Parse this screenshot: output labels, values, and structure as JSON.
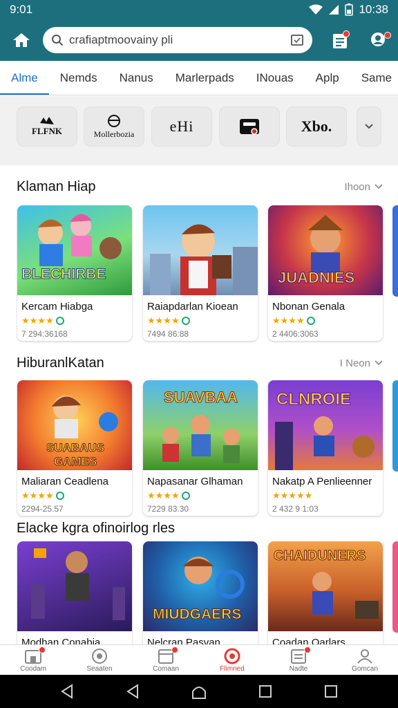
{
  "status": {
    "time": "9:01",
    "clock": "10:38"
  },
  "search": {
    "value": "crafiaptmoovainy pli"
  },
  "tabs": [
    "Alme",
    "Nemds",
    "Nanus",
    "Marlerpads",
    "INouas",
    "Aplp",
    "Same"
  ],
  "chips": [
    "FLFNK",
    "Mollerbozia",
    "eHi",
    "",
    "Xbo."
  ],
  "sections": [
    {
      "title": "Klaman Hiap",
      "see_more": "Ihoon",
      "cards": [
        {
          "title": "Kercam Hiabga",
          "meta": "7 294:36168",
          "stars": 4,
          "art_text": "BLECHIRBE"
        },
        {
          "title": "Raiapdarlan Kioean",
          "meta": "7494 86:88",
          "stars": 4,
          "art_text": ""
        },
        {
          "title": "Nbonan Genala",
          "meta": "2 4406:3063",
          "stars": 4,
          "art_text": "JUADNIES"
        }
      ]
    },
    {
      "title": "HiburanlKatan",
      "see_more": "I Neon",
      "cards": [
        {
          "title": "Maliaran Ceadlena",
          "meta": "2294-25.57",
          "stars": 4,
          "art_text": "SUABAUS GAMES"
        },
        {
          "title": "Napasanar Glhaman",
          "meta": "7229 83.30",
          "stars": 4,
          "art_text": "SUAVBAA"
        },
        {
          "title": "Nakatp A Penlieenner",
          "meta": "2 432 9 1:03",
          "stars": 5,
          "art_text": "CLNROIE"
        }
      ]
    },
    {
      "title": "Elacke kgra ofinoirlog rles",
      "see_more": "",
      "cards": [
        {
          "title": "Modhan Conabia",
          "meta": "",
          "stars": 0,
          "art_text": ""
        },
        {
          "title": "Nelcran Pasvan",
          "meta": "",
          "stars": 0,
          "art_text": "MIUDGAERS"
        },
        {
          "title": "Coadan Oarlars",
          "meta": "",
          "stars": 0,
          "art_text": "CHAIDUNERS"
        }
      ]
    }
  ],
  "bottom_nav": [
    "Coodam",
    "Seaaten",
    "Comaan",
    "Flimned",
    "Nadte",
    "Gomcan"
  ],
  "colors": {
    "appbar": "#1e6f7d",
    "accent": "#1a73c9",
    "star": "#f2a500",
    "badge_red": "#e53935"
  },
  "icons": [
    "home-icon",
    "search-icon",
    "clipboard-icon",
    "notes-icon",
    "profile-icon",
    "chevron-down-icon"
  ]
}
